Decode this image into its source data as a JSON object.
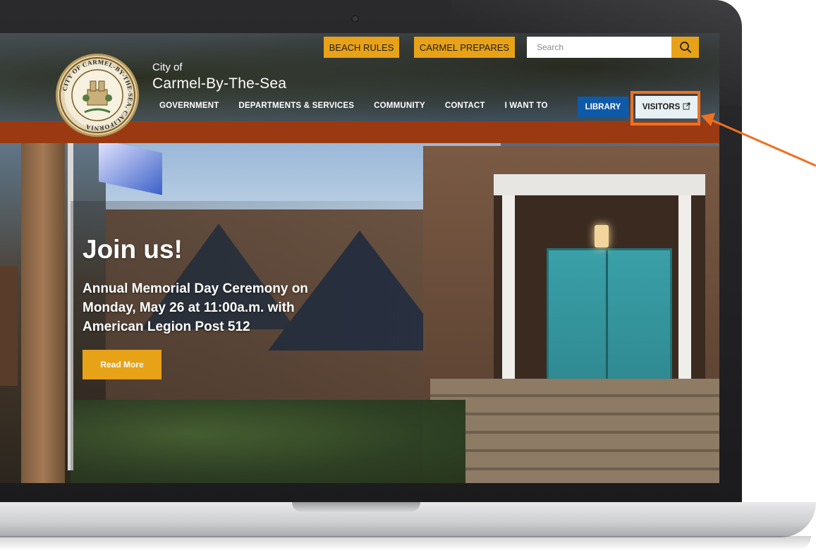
{
  "header": {
    "top_buttons": {
      "beach_rules": "BEACH RULES",
      "carmel_prepares": "CARMEL PREPARES"
    },
    "search": {
      "placeholder": "Search",
      "icon": "search-icon"
    },
    "brand": {
      "small": "City of",
      "name": "Carmel-By-The-Sea",
      "seal_text": "CITY OF CARMEL-BY-THE-SEA, CALIFORNIA"
    },
    "nav": {
      "items": [
        "GOVERNMENT",
        "DEPARTMENTS & SERVICES",
        "COMMUNITY",
        "CONTACT",
        "I WANT TO"
      ],
      "library": "LIBRARY",
      "visitors": "VISITORS",
      "visitors_icon": "external-link-icon"
    }
  },
  "hero": {
    "title": "Join us!",
    "lines": [
      "Annual Memorial Day Ceremony on",
      "Monday, May 26 at 11:00a.m. with",
      "American Legion Post 512"
    ],
    "button": "Read More"
  },
  "colors": {
    "accent": "#e7a217",
    "band": "#9b3a12",
    "library": "#0f5aa8",
    "highlight": "#f07021"
  }
}
